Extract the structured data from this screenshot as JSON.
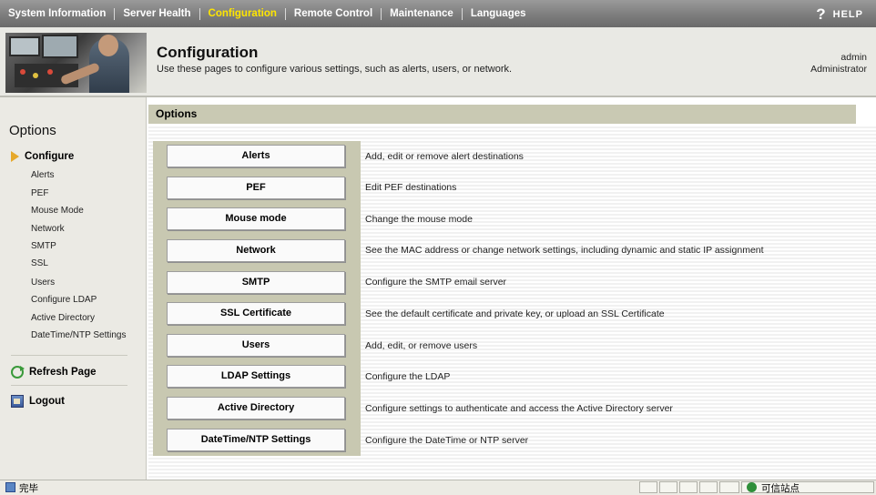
{
  "topnav": {
    "items": [
      {
        "label": "System Information"
      },
      {
        "label": "Server Health"
      },
      {
        "label": "Configuration"
      },
      {
        "label": "Remote Control"
      },
      {
        "label": "Maintenance"
      },
      {
        "label": "Languages"
      }
    ],
    "active_index": 2,
    "active_color": "#ffe600",
    "help_icon": "?",
    "help_label": "HELP"
  },
  "header": {
    "title": "Configuration",
    "subtitle": "Use these pages to configure various settings, such as alerts, users, or network.",
    "user_name": "admin",
    "user_role": "Administrator",
    "image": "operator-at-equipment-photo"
  },
  "sidebar": {
    "title": "Options",
    "section_label": "Configure",
    "links": [
      {
        "label": "Alerts"
      },
      {
        "label": "PEF"
      },
      {
        "label": "Mouse Mode"
      },
      {
        "label": "Network"
      },
      {
        "label": "SMTP"
      },
      {
        "label": "SSL"
      },
      {
        "label": "Users"
      },
      {
        "label": "Configure LDAP"
      },
      {
        "label": "Active Directory"
      },
      {
        "label": "DateTime/NTP Settings"
      }
    ],
    "refresh_label": "Refresh Page",
    "logout_label": "Logout"
  },
  "main": {
    "section_title": "Options",
    "options": [
      {
        "button": "Alerts",
        "description": "Add, edit or remove alert destinations"
      },
      {
        "button": "PEF",
        "description": "Edit PEF destinations"
      },
      {
        "button": "Mouse mode",
        "description": "Change the mouse mode"
      },
      {
        "button": "Network",
        "description": "See the MAC address or change network settings, including dynamic and static IP assignment"
      },
      {
        "button": "SMTP",
        "description": "Configure the SMTP email server"
      },
      {
        "button": "SSL Certificate",
        "description": "See the default certificate and private key, or upload an SSL Certificate"
      },
      {
        "button": "Users",
        "description": "Add, edit, or remove users"
      },
      {
        "button": "LDAP Settings",
        "description": "Configure the LDAP"
      },
      {
        "button": "Active Directory",
        "description": "Configure settings to authenticate and access the Active Directory server"
      },
      {
        "button": "DateTime/NTP Settings",
        "description": "Configure the DateTime or NTP server"
      }
    ]
  },
  "statusbar": {
    "text": "完毕",
    "zone_text": "可信站点"
  }
}
